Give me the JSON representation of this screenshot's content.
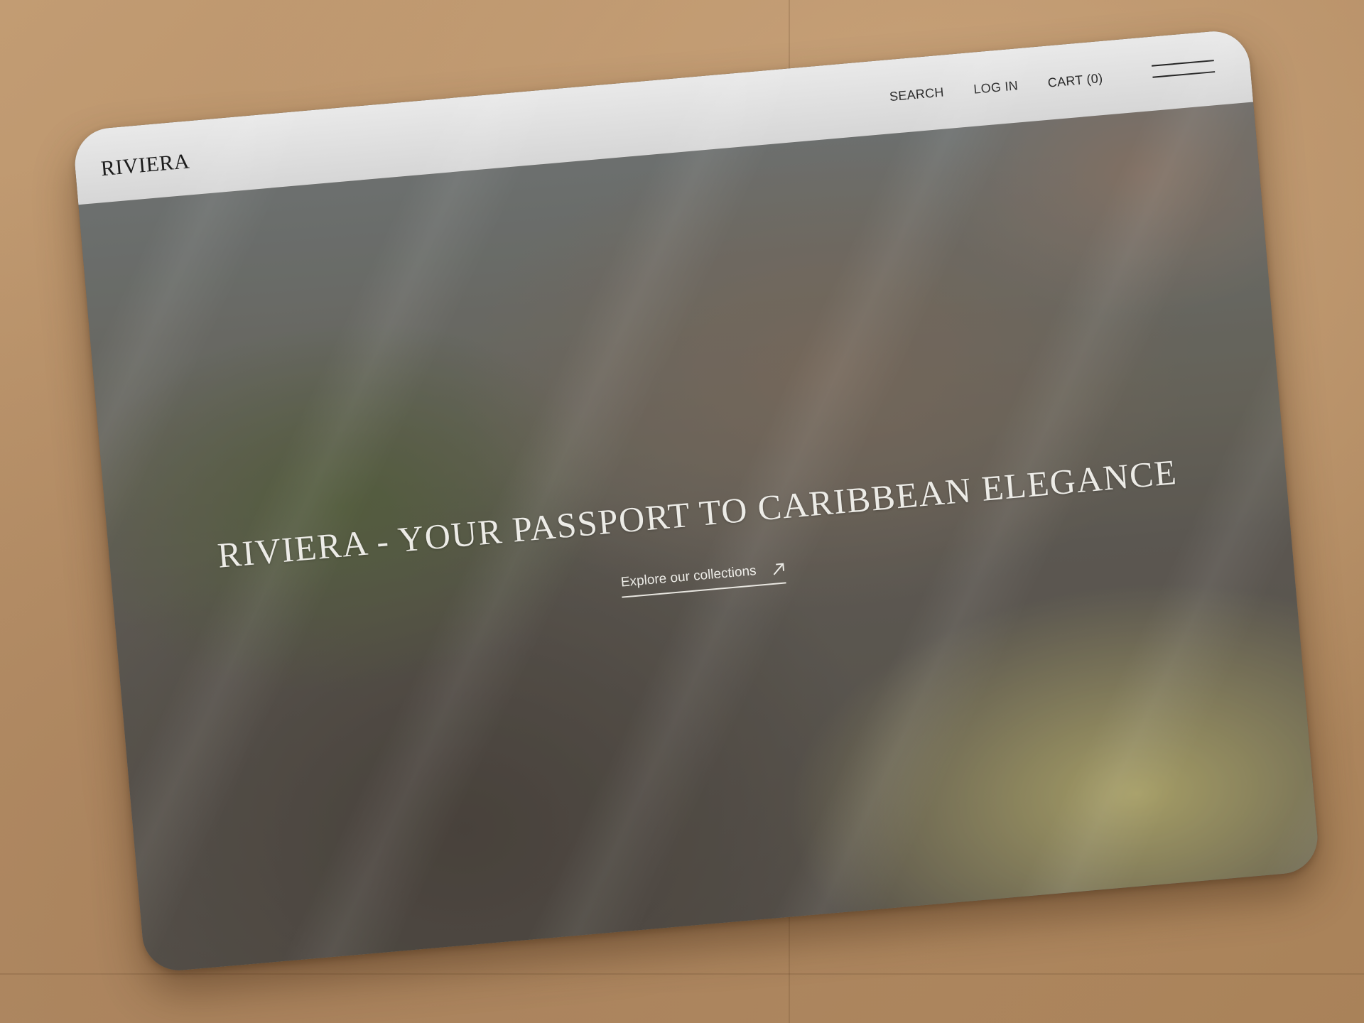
{
  "brand": {
    "logo": "RIVIERA"
  },
  "nav": {
    "search": "SEARCH",
    "login": "LOG IN",
    "cart": "CART (0)",
    "menu_icon": "hamburger-menu-icon"
  },
  "hero": {
    "title": "RIVIERA - YOUR PASSPORT TO CARIBBEAN ELEGANCE",
    "cta_label": "Explore our collections",
    "cta_icon": "arrow-up-right-icon"
  },
  "colors": {
    "background": "#b9936b",
    "navbar": "#e0e0e0",
    "hero_text": "#ecebe6"
  }
}
